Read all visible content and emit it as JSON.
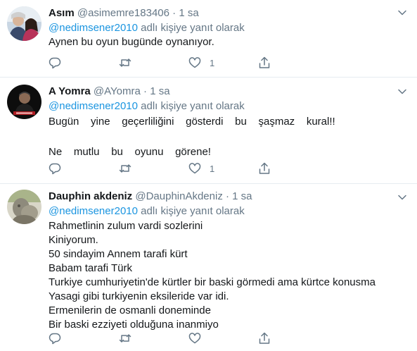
{
  "tweets": [
    {
      "name": "Asım",
      "handle": "@asimemre183406",
      "dot": "·",
      "time": "1 sa",
      "reply_mention": "@nedimsener2010",
      "reply_suffix": " adlı kişiye yanıt olarak",
      "lines": [
        "Aynen bu oyun bugünde oynanıyor."
      ],
      "likes": "1"
    },
    {
      "name": "A Yomra",
      "handle": "@AYomra",
      "dot": "·",
      "time": "1 sa",
      "reply_mention": "@nedimsener2010",
      "reply_suffix": " adlı kişiye yanıt olarak",
      "lines": [
        "Bugün    yine    geçerliliğini    gösterdi    bu    şaşmaz    kural!!",
        "",
        "Ne    mutlu    bu    oyunu    görene!"
      ],
      "likes": "1"
    },
    {
      "name": "Dauphin akdeniz",
      "handle": "@DauphinAkdeniz",
      "dot": "·",
      "time": "1 sa",
      "reply_mention": "@nedimsener2010",
      "reply_suffix": " adlı kişiye yanıt olarak",
      "lines": [
        "Rahmetlinin zulum vardi sozlerini",
        "Kiniyorum.",
        "50 sindayim Annem tarafi kürt",
        "Babam tarafi Türk",
        "Turkiye cumhuriyetin'de kürtler bir baski görmedi ama kürtce konusma",
        "Yasagi gibi turkiyenin eksileride var idi.",
        "Ermenilerin de osmanli doneminde",
        "Bir baski ezziyeti olduğuna inanmiyo"
      ],
      "likes": ""
    }
  ],
  "icons": {
    "reply": "reply-icon",
    "retweet": "retweet-icon",
    "like": "heart-icon",
    "share": "share-icon",
    "more": "chevron-down-icon"
  },
  "colors": {
    "text": "#14171a",
    "secondary": "#657786",
    "link": "#1b95e0",
    "divider": "#e6ecf0"
  }
}
